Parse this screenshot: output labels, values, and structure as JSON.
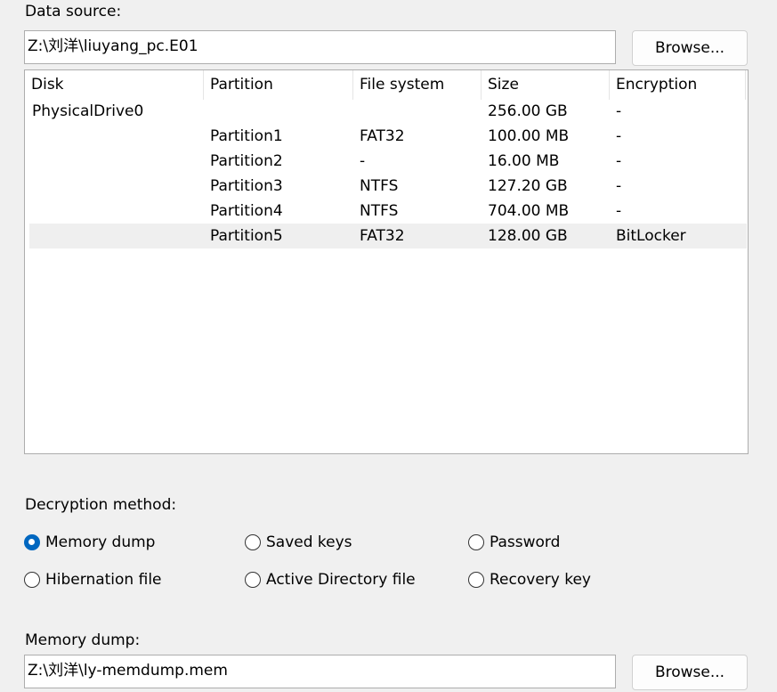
{
  "data_source": {
    "label": "Data source:",
    "path": "Z:\\刘洋\\liuyang_pc.E01",
    "browse_label": "Browse..."
  },
  "table": {
    "columns": [
      "Disk",
      "Partition",
      "File system",
      "Size",
      "Encryption"
    ],
    "rows": [
      {
        "disk": "PhysicalDrive0",
        "partition": "",
        "fs": "",
        "size": "256.00 GB",
        "encryption": "-"
      },
      {
        "disk": "",
        "partition": "Partition1",
        "fs": "FAT32",
        "size": "100.00 MB",
        "encryption": "-"
      },
      {
        "disk": "",
        "partition": "Partition2",
        "fs": "-",
        "size": "16.00 MB",
        "encryption": "-"
      },
      {
        "disk": "",
        "partition": "Partition3",
        "fs": "NTFS",
        "size": "127.20 GB",
        "encryption": "-"
      },
      {
        "disk": "",
        "partition": "Partition4",
        "fs": "NTFS",
        "size": "704.00 MB",
        "encryption": "-"
      },
      {
        "disk": "",
        "partition": "Partition5",
        "fs": "FAT32",
        "size": "128.00 GB",
        "encryption": "BitLocker"
      }
    ]
  },
  "decryption": {
    "label": "Decryption method:",
    "options": [
      {
        "label": "Memory dump",
        "checked": true
      },
      {
        "label": "Saved keys",
        "checked": false
      },
      {
        "label": "Password",
        "checked": false
      },
      {
        "label": "Hibernation file",
        "checked": false
      },
      {
        "label": "Active Directory file",
        "checked": false
      },
      {
        "label": "Recovery key",
        "checked": false
      }
    ]
  },
  "memory_dump": {
    "label": "Memory dump:",
    "path": "Z:\\刘洋\\ly-memdump.mem",
    "browse_label": "Browse..."
  }
}
